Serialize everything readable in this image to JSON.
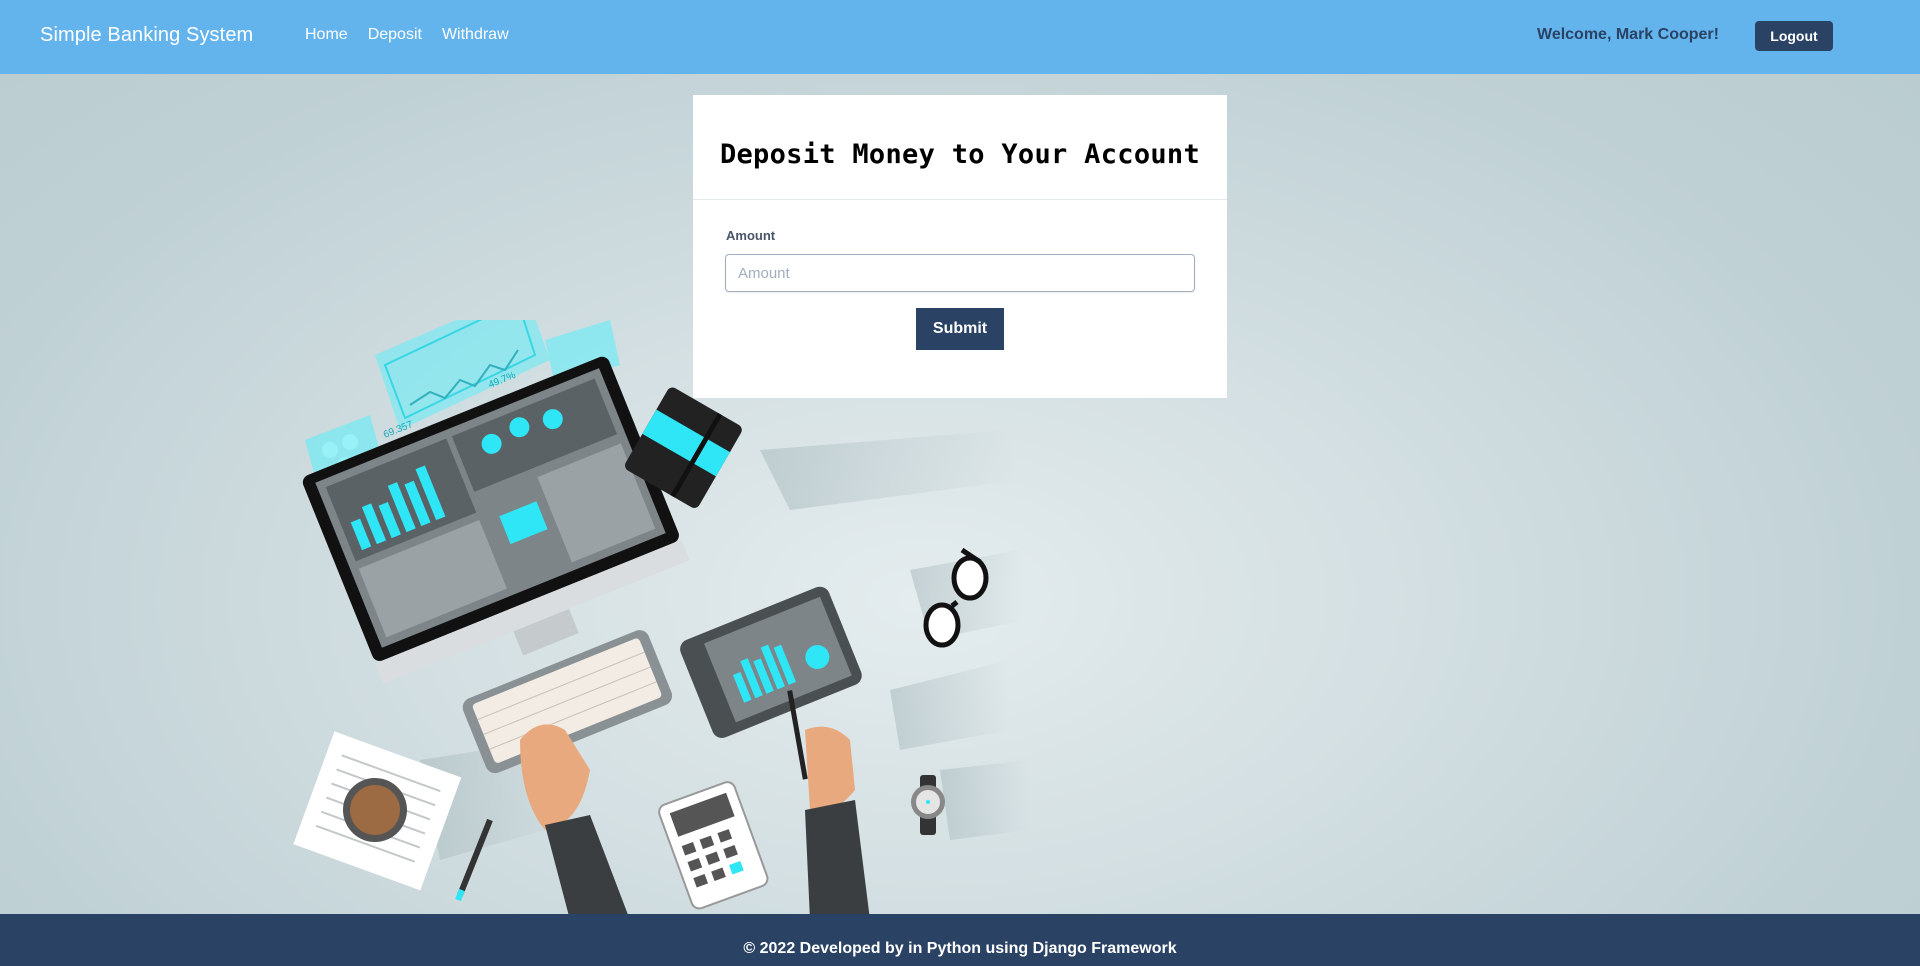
{
  "navbar": {
    "brand": "Simple Banking System",
    "links": [
      {
        "label": "Home"
      },
      {
        "label": "Deposit"
      },
      {
        "label": "Withdraw"
      }
    ],
    "welcome": "Welcome, Mark Cooper!",
    "logout_label": "Logout"
  },
  "form": {
    "title": "Deposit Money to Your Account",
    "amount_label": "Amount",
    "amount_placeholder": "Amount",
    "amount_value": "",
    "submit_label": "Submit"
  },
  "footer": {
    "text": "© 2022 Developed by in Python using Django Framework"
  },
  "colors": {
    "navbar": "#63b3ed",
    "primary_dark": "#2a4365",
    "accent_cyan": "#2ee6f5"
  },
  "illustration": {
    "icon": "workspace-illustration-icon",
    "screen_values": [
      "69.357",
      "49.7%"
    ]
  }
}
